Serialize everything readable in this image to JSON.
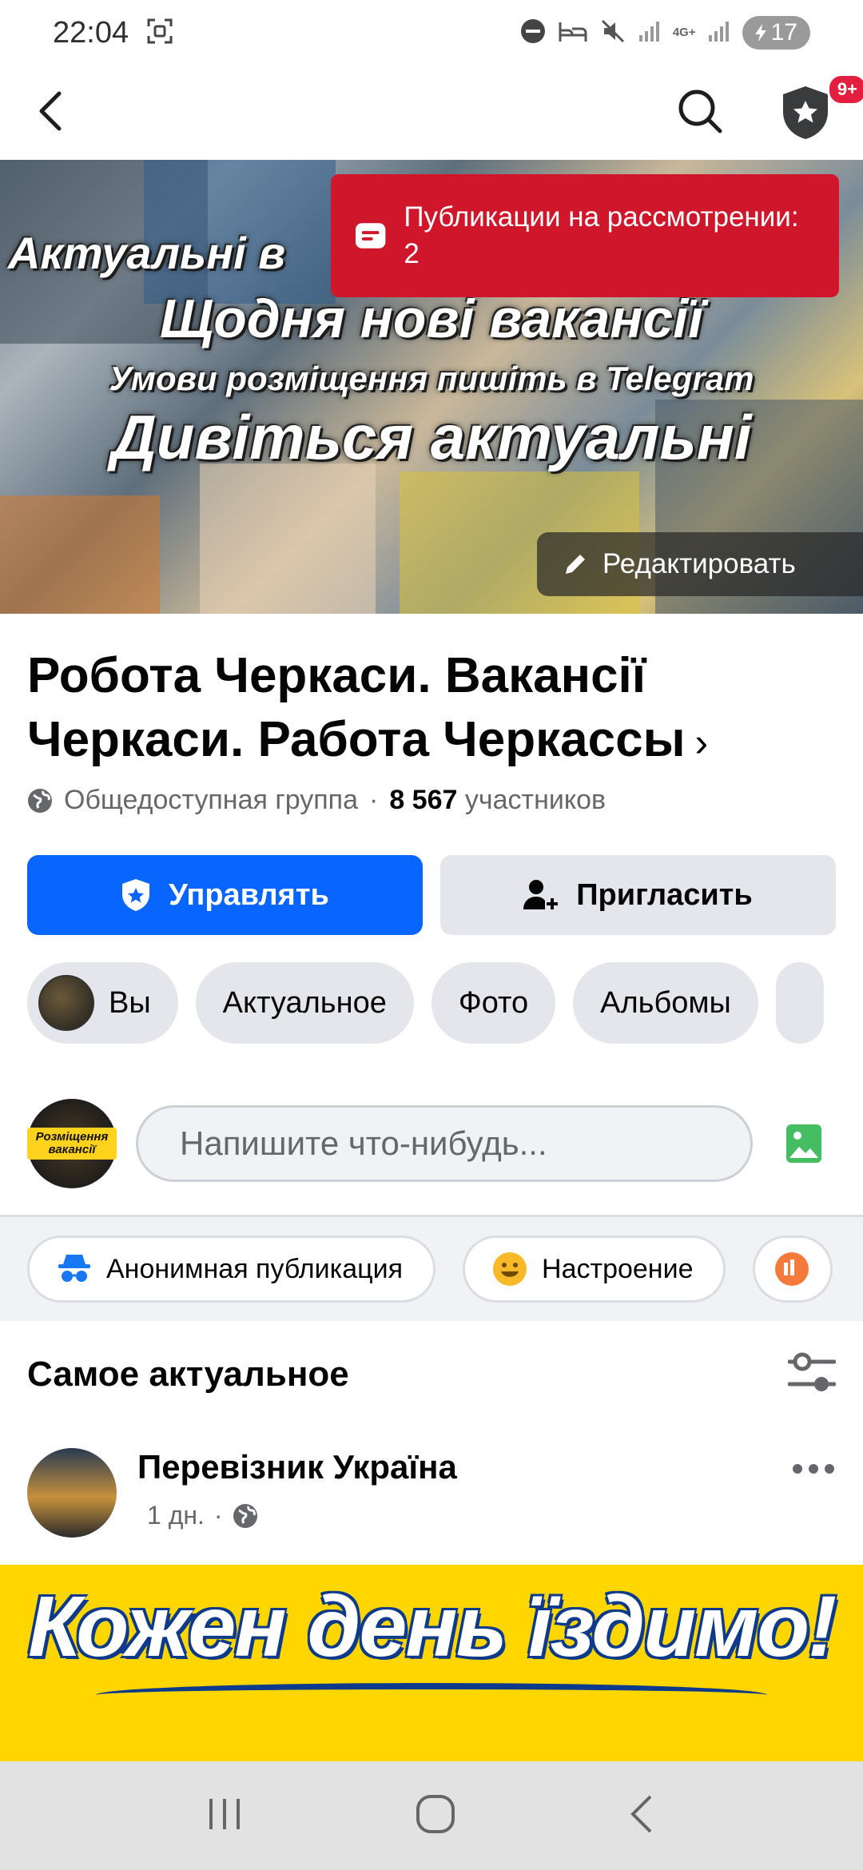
{
  "status_bar": {
    "time": "22:04",
    "network": "4G+",
    "battery": "17"
  },
  "cover": {
    "lines": [
      "Актуальні в",
      "Щодня нові вакансії",
      "Умови розміщення пишіть в Telegram",
      "Дивіться актуальні"
    ],
    "review_banner": "Публикации на рассмотрении: 2",
    "edit_label": "Редактировать"
  },
  "nav": {
    "notifications_badge": "9+"
  },
  "group": {
    "title": "Робота Черкаси. Вакансії Черкаси. Работа Черкассы",
    "title_chevron": "›",
    "privacy": "Общедоступная группа",
    "separator": "·",
    "members_count": "8 567",
    "members_label": "участников"
  },
  "actions": {
    "manage_label": "Управлять",
    "invite_label": "Пригласить"
  },
  "chips": {
    "you": "Вы",
    "featured": "Актуальное",
    "photos": "Фото",
    "albums": "Альбомы"
  },
  "composer": {
    "placeholder": "Напишите что-нибудь...",
    "avatar_text": "Розміщення вакансії"
  },
  "post_types": {
    "anonymous": "Анонимная публикация",
    "feeling": "Настроение"
  },
  "feed": {
    "title": "Самое актуальное"
  },
  "post": {
    "author": "Перевізник Україна",
    "time": "1 дн.",
    "separator": "·",
    "image_text": "Кожен день їздимо!"
  },
  "colors": {
    "primary_blue": "#0866ff",
    "review_red": "#d0162a",
    "chip_gray": "#e4e6eb",
    "photo_green": "#45bd62",
    "feeling_yellow": "#f7b928"
  }
}
